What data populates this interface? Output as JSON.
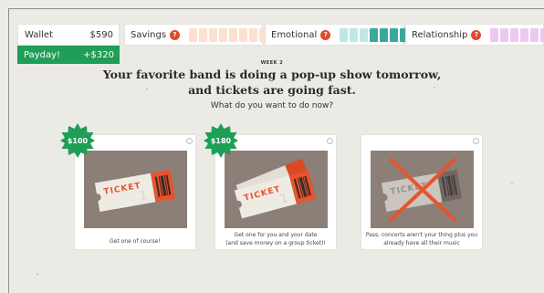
{
  "wallet": {
    "label": "Wallet",
    "value": "$590"
  },
  "payday": {
    "label": "Payday!",
    "value": "+$320"
  },
  "meters": {
    "savings": {
      "label": "Savings",
      "info": "?",
      "level": 0,
      "segments": 8,
      "colors": {
        "filled": "#f2a37f",
        "empty": "#fde0cf"
      }
    },
    "emotional": {
      "label": "Emotional",
      "info": "?",
      "level": 5,
      "segments": 8,
      "colors": {
        "filled": "#3aa89c",
        "empty": "#bfe8e4"
      }
    },
    "relationship": {
      "label": "Relationship",
      "info": "?",
      "level": 1,
      "segments": 8,
      "colors": {
        "filled": "#9e64b0",
        "empty": "#ecc9f0"
      }
    }
  },
  "week_label": "WEEK 2",
  "headline": {
    "line1": "Your favorite band is doing a pop-up show tomorrow,",
    "line2": "and tickets are going fast."
  },
  "question": "What do you want to do now?",
  "options": [
    {
      "price": "$100",
      "caption_line1": "Get one of course!",
      "caption_line2": "",
      "ticket_text": "TICKET",
      "ticket_number": "1",
      "icon": "single-ticket"
    },
    {
      "price": "$180",
      "caption_line1": "Get one for you and your date",
      "caption_line2": "(and save money on a group ticket)!",
      "ticket_text": "TICKET",
      "ticket_number": "1",
      "icon": "two-tickets"
    },
    {
      "price": "",
      "caption_line1": "Pass, concerts aren't your thing plus you",
      "caption_line2": "already have all their music",
      "ticket_text": "TICKET",
      "icon": "crossed-out-ticket"
    }
  ],
  "colors": {
    "payday_bg": "#1f9e57",
    "badge": "#1f9e57",
    "info_dot": "#e04a2a",
    "ticket_orange": "#e8542c",
    "cross_red": "#e8542c"
  }
}
